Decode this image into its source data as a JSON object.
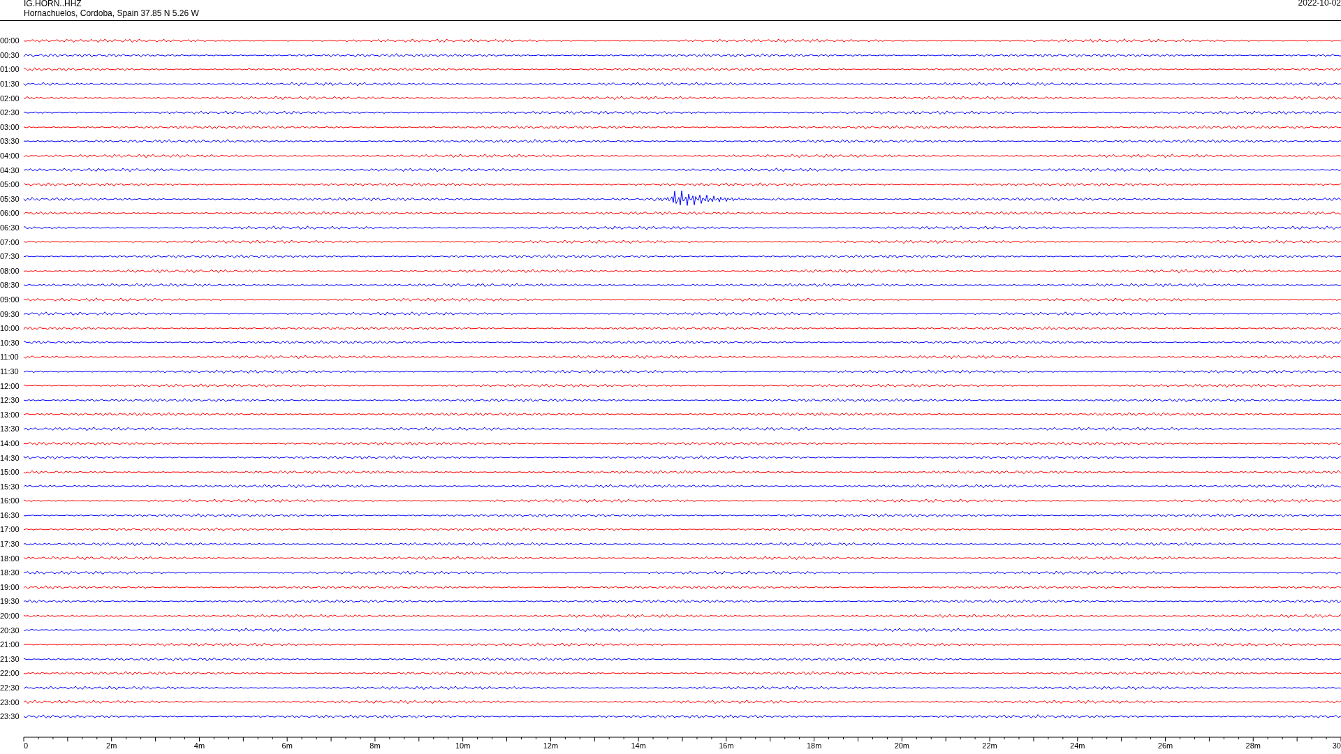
{
  "header": {
    "station": "IG.HORN..HHZ",
    "location": "Hornachuelos, Cordoba, Spain  37.85 N 5.26 W",
    "date": "2022-10-02"
  },
  "rows": [
    {
      "time": "00:00",
      "color": "#ff0000"
    },
    {
      "time": "00:30",
      "color": "#0000ff"
    },
    {
      "time": "01:00",
      "color": "#ff0000"
    },
    {
      "time": "01:30",
      "color": "#0000ff"
    },
    {
      "time": "02:00",
      "color": "#ff0000"
    },
    {
      "time": "02:30",
      "color": "#0000ff"
    },
    {
      "time": "03:00",
      "color": "#ff0000"
    },
    {
      "time": "03:30",
      "color": "#0000ff"
    },
    {
      "time": "04:00",
      "color": "#ff0000"
    },
    {
      "time": "04:30",
      "color": "#0000ff"
    },
    {
      "time": "05:00",
      "color": "#ff0000"
    },
    {
      "time": "05:30",
      "color": "#0000ff"
    },
    {
      "time": "06:00",
      "color": "#ff0000"
    },
    {
      "time": "06:30",
      "color": "#0000ff"
    },
    {
      "time": "07:00",
      "color": "#ff0000"
    },
    {
      "time": "07:30",
      "color": "#0000ff"
    },
    {
      "time": "08:00",
      "color": "#ff0000"
    },
    {
      "time": "08:30",
      "color": "#0000ff"
    },
    {
      "time": "09:00",
      "color": "#ff0000"
    },
    {
      "time": "09:30",
      "color": "#0000ff"
    },
    {
      "time": "10:00",
      "color": "#ff0000"
    },
    {
      "time": "10:30",
      "color": "#0000ff"
    },
    {
      "time": "11:00",
      "color": "#ff0000"
    },
    {
      "time": "11:30",
      "color": "#0000ff"
    },
    {
      "time": "12:00",
      "color": "#ff0000"
    },
    {
      "time": "12:30",
      "color": "#0000ff"
    },
    {
      "time": "13:00",
      "color": "#ff0000"
    },
    {
      "time": "13:30",
      "color": "#0000ff"
    },
    {
      "time": "14:00",
      "color": "#ff0000"
    },
    {
      "time": "14:30",
      "color": "#0000ff"
    },
    {
      "time": "15:00",
      "color": "#ff0000"
    },
    {
      "time": "15:30",
      "color": "#0000ff"
    },
    {
      "time": "16:00",
      "color": "#ff0000"
    },
    {
      "time": "16:30",
      "color": "#0000ff"
    },
    {
      "time": "17:00",
      "color": "#ff0000"
    },
    {
      "time": "17:30",
      "color": "#0000ff"
    },
    {
      "time": "18:00",
      "color": "#ff0000"
    },
    {
      "time": "18:30",
      "color": "#0000ff"
    },
    {
      "time": "19:00",
      "color": "#ff0000"
    },
    {
      "time": "19:30",
      "color": "#0000ff"
    },
    {
      "time": "20:00",
      "color": "#ff0000"
    },
    {
      "time": "20:30",
      "color": "#0000ff"
    },
    {
      "time": "21:00",
      "color": "#ff0000"
    },
    {
      "time": "21:30",
      "color": "#0000ff"
    },
    {
      "time": "22:00",
      "color": "#ff0000"
    },
    {
      "time": "22:30",
      "color": "#0000ff"
    },
    {
      "time": "23:00",
      "color": "#ff0000"
    },
    {
      "time": "23:30",
      "color": "#0000ff"
    }
  ],
  "axis": {
    "labels": [
      "0",
      "2m",
      "4m",
      "6m",
      "8m",
      "10m",
      "12m",
      "14m",
      "16m",
      "18m",
      "20m",
      "22m",
      "24m",
      "26m",
      "28m",
      "30"
    ]
  }
}
